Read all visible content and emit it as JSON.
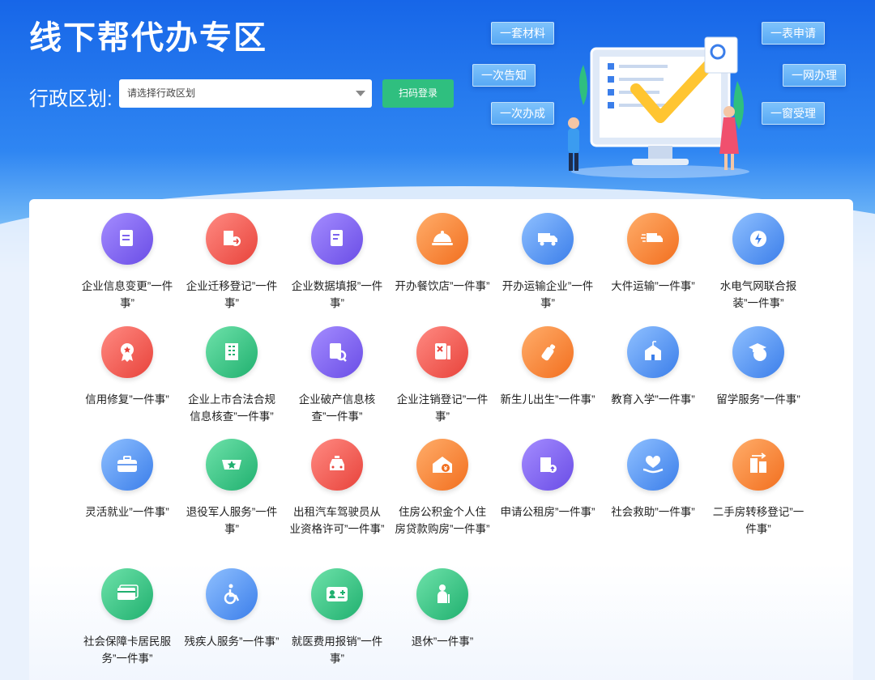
{
  "header": {
    "title": "线下帮代办专区",
    "region_label": "行政区划:",
    "region_placeholder": "请选择行政区划",
    "scan_login": "扫码登录"
  },
  "banner_tags": [
    "一套材料",
    "一次告知",
    "一次办成",
    "一表申请",
    "一网办理",
    "一窗受理"
  ],
  "services": [
    {
      "label": "企业信息变更”一件事”",
      "icon": "exchange-doc-icon",
      "color": "purple"
    },
    {
      "label": "企业迁移登记”一件事”",
      "icon": "building-transfer-icon",
      "color": "red"
    },
    {
      "label": "企业数据填报”一件事”",
      "icon": "edit-doc-icon",
      "color": "purple"
    },
    {
      "label": "开办餐饮店”一件事”",
      "icon": "food-cloche-icon",
      "color": "orange"
    },
    {
      "label": "开办运输企业”一件事”",
      "icon": "truck-icon",
      "color": "blue"
    },
    {
      "label": "大件运输”一件事”",
      "icon": "fast-truck-icon",
      "color": "orange"
    },
    {
      "label": "水电气网联合报装”一件事”",
      "icon": "utility-drop-icon",
      "color": "blue"
    },
    {
      "label": "信用修复”一件事”",
      "icon": "credit-badge-icon",
      "color": "red"
    },
    {
      "label": "企业上市合法合规信息核查”一件事”",
      "icon": "building-icon",
      "color": "green"
    },
    {
      "label": "企业破产信息核查”一件事”",
      "icon": "doc-search-icon",
      "color": "purple"
    },
    {
      "label": "企业注销登记”一件事”",
      "icon": "doc-cancel-icon",
      "color": "red"
    },
    {
      "label": "新生儿出生”一件事”",
      "icon": "baby-bottle-icon",
      "color": "orange"
    },
    {
      "label": "教育入学”一件事”",
      "icon": "school-icon",
      "color": "blue"
    },
    {
      "label": "留学服务”一件事”",
      "icon": "graduation-globe-icon",
      "color": "blue"
    },
    {
      "label": "灵活就业”一件事”",
      "icon": "briefcase-icon",
      "color": "blue"
    },
    {
      "label": "退役军人服务”一件事”",
      "icon": "military-star-icon",
      "color": "green"
    },
    {
      "label": "出租汽车驾驶员从业资格许可”一件事”",
      "icon": "taxi-icon",
      "color": "red"
    },
    {
      "label": "住房公积金个人住房贷款购房”一件事”",
      "icon": "house-fund-icon",
      "color": "orange"
    },
    {
      "label": "申请公租房”一件事”",
      "icon": "public-housing-icon",
      "color": "purple"
    },
    {
      "label": "社会救助”一件事”",
      "icon": "heart-hand-icon",
      "color": "blue"
    },
    {
      "label": "二手房转移登记”一件事”",
      "icon": "house-transfer-icon",
      "color": "orange"
    },
    {
      "label": "社会保障卡居民服务”一件事”",
      "icon": "social-card-icon",
      "color": "green"
    },
    {
      "label": "残疾人服务”一件事”",
      "icon": "wheelchair-icon",
      "color": "blue"
    },
    {
      "label": "就医费用报销”一件事”",
      "icon": "medical-card-icon",
      "color": "green"
    },
    {
      "label": "退休”一件事”",
      "icon": "elder-icon",
      "color": "green"
    }
  ]
}
